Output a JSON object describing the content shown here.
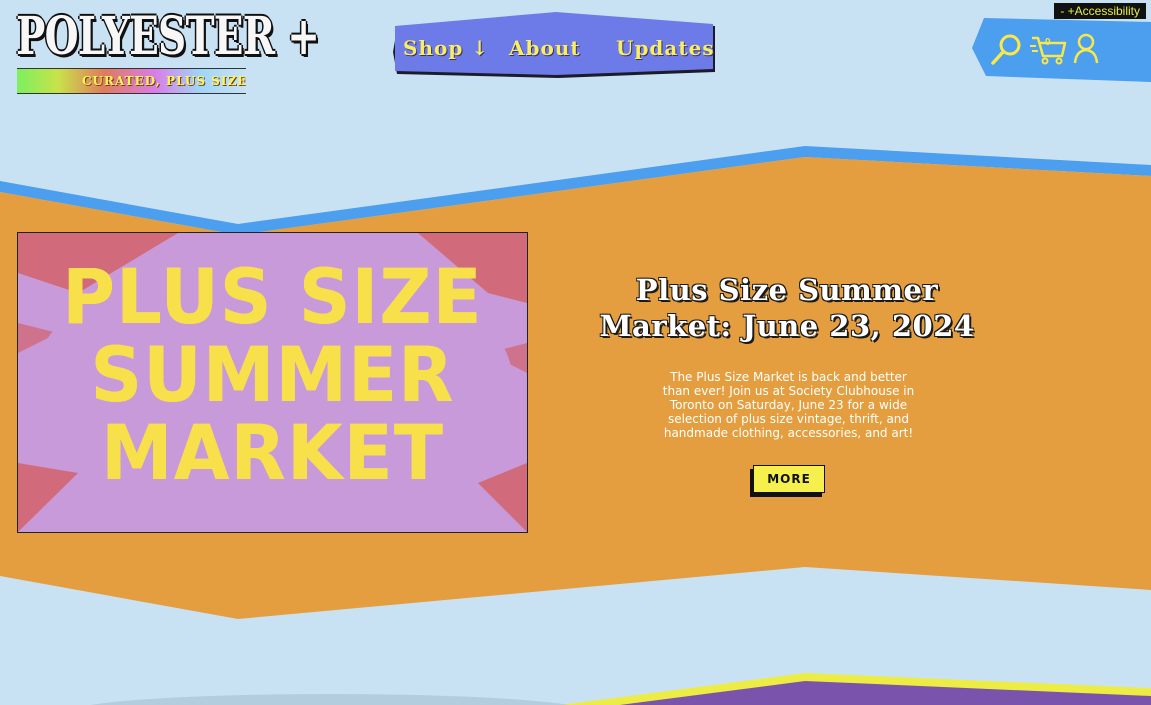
{
  "accessibility": {
    "label": "- +Accessibility"
  },
  "logo": {
    "title": "POLYESTER +",
    "tagline": "CURATED, PLUS SIZE VINTAGE"
  },
  "nav": {
    "items": [
      {
        "label": "Shop ↓"
      },
      {
        "label": "About"
      },
      {
        "label": "Updates"
      }
    ]
  },
  "header_icons": {
    "search": "search-icon",
    "cart": "cart-icon",
    "cart_count": "0",
    "account": "account-icon"
  },
  "hero": {
    "image_lines": [
      "PLUS SIZE",
      "SUMMER",
      "MARKET"
    ],
    "headline": "Plus Size Summer Market: June 23, 2024",
    "description": "The Plus Size Market is back and better than ever! Join us at Society Clubhouse in Toronto on Saturday, June 23 for a wide selection of plus size vintage, thrift, and handmade clothing, accessories, and art!",
    "more_label": "MORE"
  },
  "colors": {
    "background": "#c8e2f4",
    "hero_band": "#e49e3f",
    "band_border": "#4c9eee",
    "nav_bg": "#6c7be8",
    "accent_yellow": "#f6f04e",
    "promo_bg": "#c79ad7"
  }
}
